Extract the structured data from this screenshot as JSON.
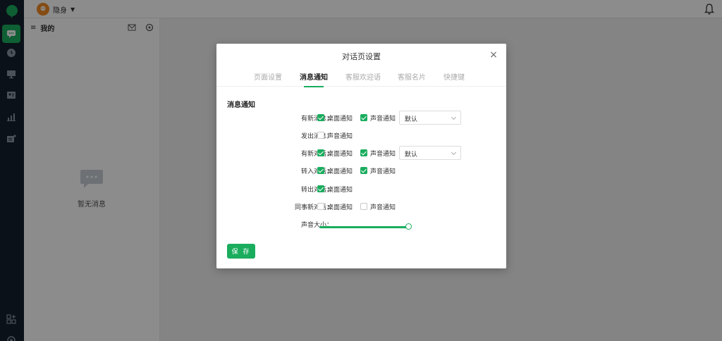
{
  "app": {
    "status_label": "隐身",
    "status_caret": "▼"
  },
  "panel": {
    "menu_icon": "≡",
    "title": "我的",
    "empty_text": "暂无消息"
  },
  "modal": {
    "title": "对话页设置",
    "close_label": "×",
    "tabs": [
      {
        "label": "页面设置",
        "active": false
      },
      {
        "label": "消息通知",
        "active": true
      },
      {
        "label": "客服欢迎语",
        "active": false
      },
      {
        "label": "客服名片",
        "active": false
      },
      {
        "label": "快捷键",
        "active": false
      }
    ],
    "section_title": "消息通知",
    "rows": [
      {
        "label": "有新消息：",
        "desktop": "桌面通知",
        "desktop_checked": true,
        "sound": "声音通知",
        "sound_checked": true,
        "select_value": "默认"
      },
      {
        "label": "发出消息：",
        "sound": "声音通知",
        "sound_checked": false
      },
      {
        "label": "有新对话：",
        "desktop": "桌面通知",
        "desktop_checked": true,
        "sound": "声音通知",
        "sound_checked": true,
        "select_value": "默认"
      },
      {
        "label": "转入对话：",
        "desktop": "桌面通知",
        "desktop_checked": true,
        "sound": "声音通知",
        "sound_checked": true
      },
      {
        "label": "转出对话：",
        "desktop": "桌面通知",
        "desktop_checked": true
      },
      {
        "label": "同事新对话：",
        "desktop": "桌面通知",
        "desktop_checked": false,
        "sound": "声音通知",
        "sound_checked": false
      }
    ],
    "volume_label": "声音大小：",
    "volume_value": 1.0,
    "save_label": "保 存"
  },
  "colors": {
    "accent": "#1aad5e",
    "rail": "#15202c",
    "status_avatar": "#f08a24"
  }
}
